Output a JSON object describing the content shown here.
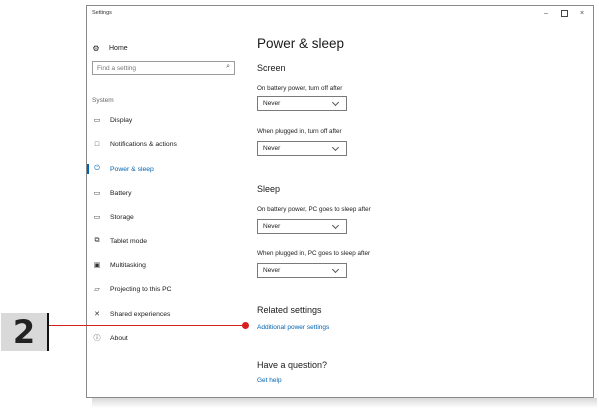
{
  "window": {
    "title": "Settings",
    "minimize_glyph": "–",
    "close_glyph": "×"
  },
  "nav": {
    "home_label": "Home",
    "home_icon": "gear-icon",
    "search_placeholder": "Find a setting",
    "section_label": "System",
    "items": [
      {
        "label": "Display",
        "icon": "monitor-icon",
        "glyph": "▭",
        "active": false
      },
      {
        "label": "Notifications & actions",
        "icon": "notification-icon",
        "glyph": "□",
        "active": false
      },
      {
        "label": "Power & sleep",
        "icon": "power-icon",
        "glyph": "⏻",
        "active": true
      },
      {
        "label": "Battery",
        "icon": "battery-icon",
        "glyph": "▭",
        "active": false
      },
      {
        "label": "Storage",
        "icon": "storage-icon",
        "glyph": "▭",
        "active": false
      },
      {
        "label": "Tablet mode",
        "icon": "tablet-icon",
        "glyph": "⧉",
        "active": false
      },
      {
        "label": "Multitasking",
        "icon": "multitasking-icon",
        "glyph": "▣",
        "active": false
      },
      {
        "label": "Projecting to this PC",
        "icon": "projector-icon",
        "glyph": "▱",
        "active": false
      },
      {
        "label": "Shared experiences",
        "icon": "shared-icon",
        "glyph": "✕",
        "active": false
      },
      {
        "label": "About",
        "icon": "info-icon",
        "glyph": "ⓘ",
        "active": false
      }
    ]
  },
  "main": {
    "title": "Power & sleep",
    "screen_heading": "Screen",
    "screen_battery_label": "On battery power, turn off after",
    "screen_battery_value": "Never",
    "screen_plugged_label": "When plugged in, turn off after",
    "screen_plugged_value": "Never",
    "sleep_heading": "Sleep",
    "sleep_battery_label": "On battery power, PC goes to sleep after",
    "sleep_battery_value": "Never",
    "sleep_plugged_label": "When plugged in, PC goes to sleep after",
    "sleep_plugged_value": "Never",
    "related_heading": "Related settings",
    "related_link": "Additional power settings",
    "question_heading": "Have a question?",
    "help_link": "Get help"
  },
  "callout": {
    "number": "2",
    "color": "#d62020"
  },
  "colors": {
    "accent": "#0063b1"
  }
}
